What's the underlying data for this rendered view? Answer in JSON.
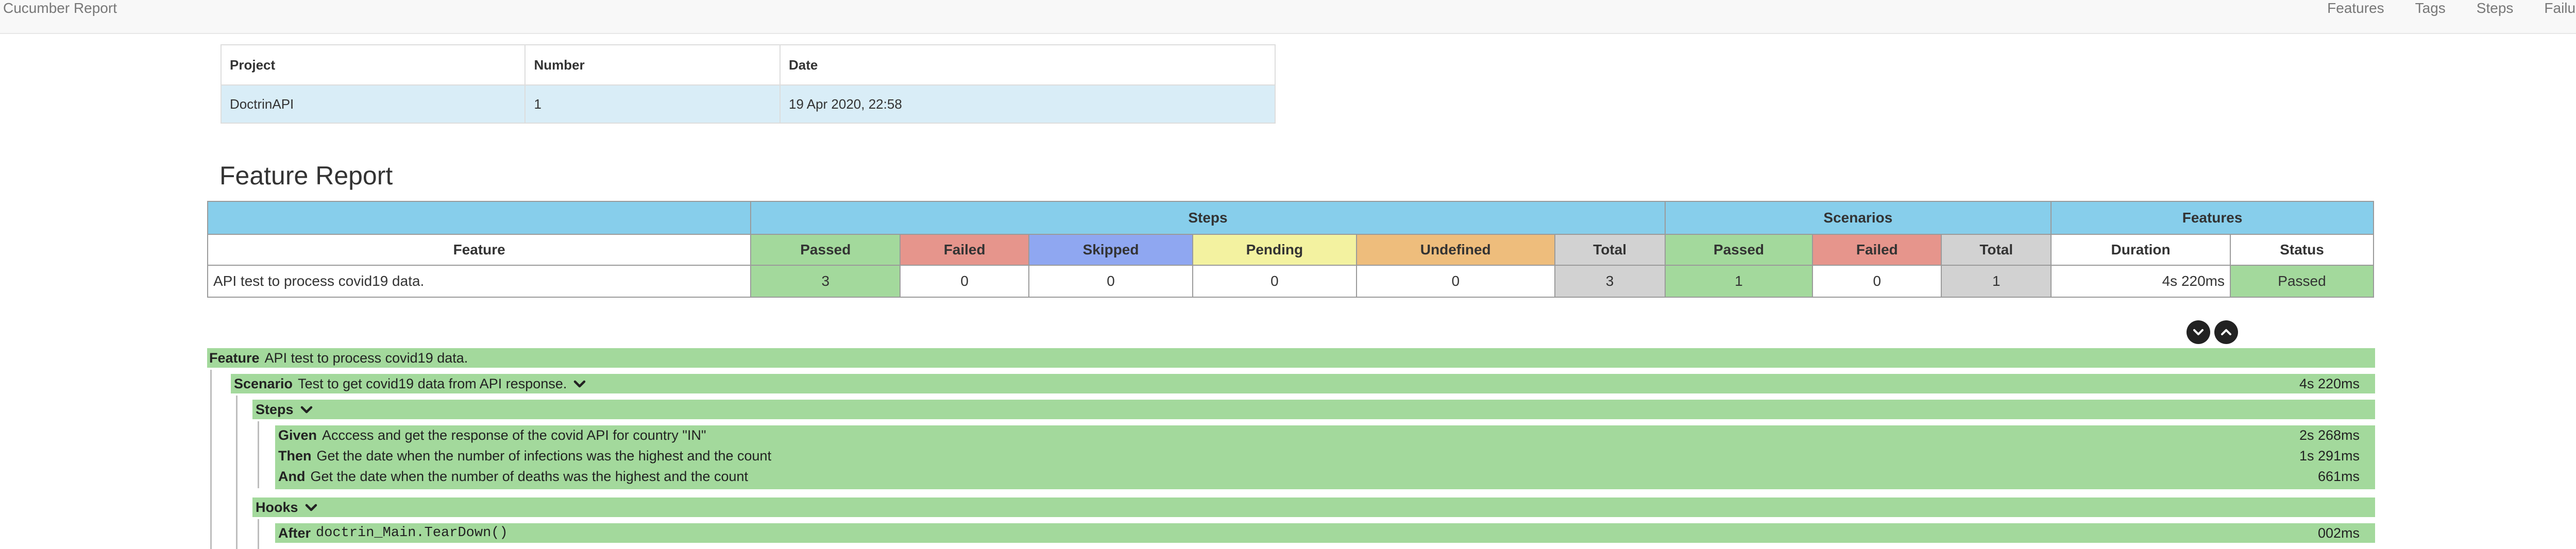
{
  "navbar": {
    "brand": "Cucumber Report",
    "links": [
      "Features",
      "Tags",
      "Steps",
      "Failures"
    ]
  },
  "info": {
    "headers": [
      "Project",
      "Number",
      "Date"
    ],
    "row": [
      "DoctrinAPI",
      "1",
      "19 Apr 2020, 22:58"
    ]
  },
  "report": {
    "title": "Feature Report",
    "groups": [
      "Steps",
      "Scenarios",
      "Features"
    ],
    "columns": [
      "Feature",
      "Passed",
      "Failed",
      "Skipped",
      "Pending",
      "Undefined",
      "Total",
      "Passed",
      "Failed",
      "Total",
      "Duration",
      "Status"
    ],
    "row": [
      "API test to process covid19 data.",
      "3",
      "0",
      "0",
      "0",
      "0",
      "3",
      "1",
      "0",
      "1",
      "4s 220ms",
      "Passed"
    ]
  },
  "details": {
    "feature_keyword": "Feature",
    "feature_name": "API test to process covid19 data.",
    "scenario_keyword": "Scenario",
    "scenario_name": "Test to get covid19 data from API response.",
    "scenario_duration": "4s 220ms",
    "steps_label": "Steps",
    "steps": [
      {
        "keyword": "Given",
        "text": "Acccess and get the response of the covid API for country \"IN\"",
        "duration": "2s 268ms"
      },
      {
        "keyword": "Then",
        "text": "Get the date when the number of infections was the highest and the count",
        "duration": "1s 291ms"
      },
      {
        "keyword": "And",
        "text": "Get the date when the number of deaths was the highest and the count",
        "duration": "661ms"
      }
    ],
    "hooks_label": "Hooks",
    "hook": {
      "keyword": "After",
      "text": "doctrin_Main.TearDown()",
      "duration": "002ms"
    }
  },
  "colors": {
    "passed": "#a3d99c",
    "failed": "#e6958c",
    "skipped": "#8fa7f1",
    "pending": "#f3f2a0",
    "undefined": "#eebd7c",
    "total": "#d2d2d2",
    "header": "#87ceeb",
    "info_row": "#d9edf7"
  },
  "icons": [
    "chevron-down-circle-icon",
    "chevron-up-circle-icon",
    "chevron-down-icon"
  ]
}
